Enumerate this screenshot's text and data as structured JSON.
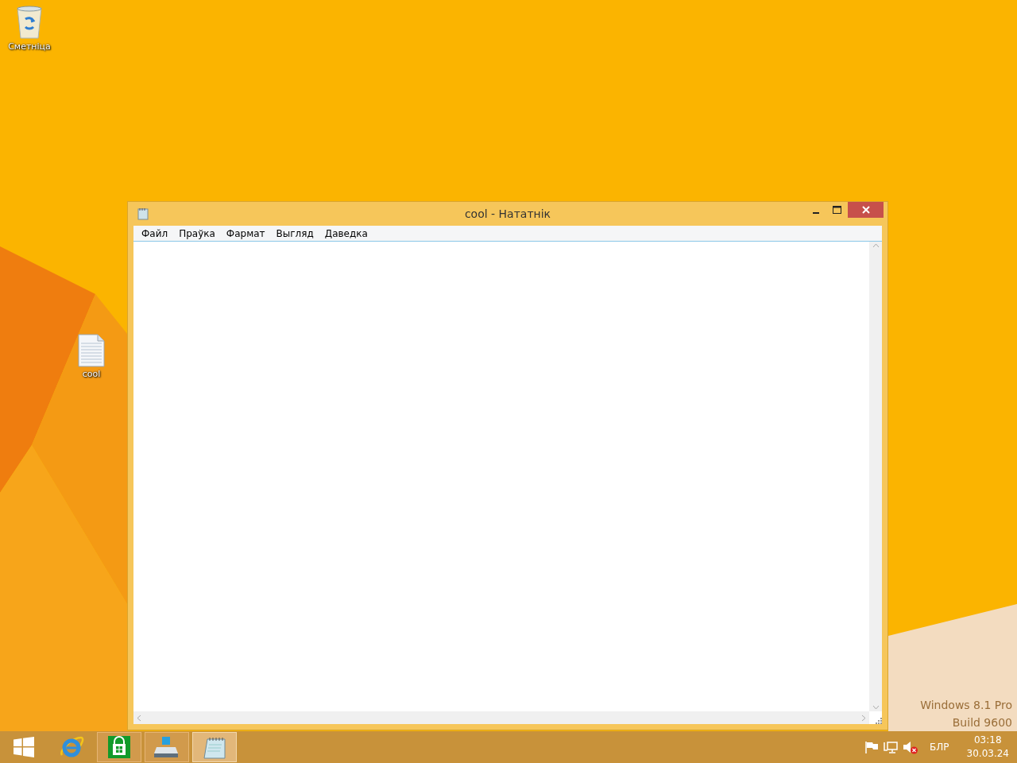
{
  "desktop_icons": [
    {
      "kind": "recycle-bin",
      "label": "Сметніца"
    },
    {
      "kind": "text-file",
      "label": "cool"
    }
  ],
  "window": {
    "title": "cool - Нататнік",
    "menu": [
      "Файл",
      "Праўка",
      "Фармат",
      "Выгляд",
      "Даведка"
    ]
  },
  "edition": [
    "Windows 8.1 Pro",
    "Build 9600"
  ],
  "taskbar": {
    "items": [
      {
        "kind": "start",
        "running": false,
        "selected": false
      },
      {
        "kind": "browser",
        "running": false,
        "selected": false
      },
      {
        "kind": "store",
        "running": true,
        "selected": false
      },
      {
        "kind": "explorer",
        "running": true,
        "selected": false
      },
      {
        "kind": "notepad",
        "running": true,
        "selected": true
      }
    ],
    "tray": {
      "muted": true,
      "language": "БЛР",
      "time": "03:18",
      "date": "30.03.24"
    }
  }
}
